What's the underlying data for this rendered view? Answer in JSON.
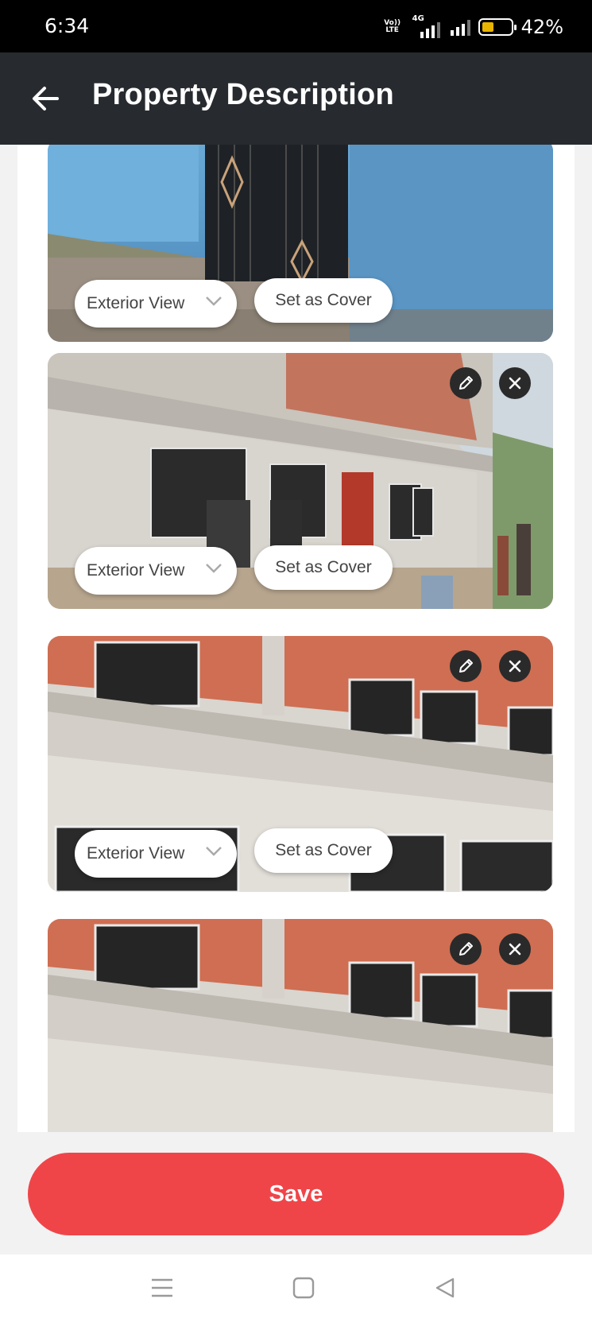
{
  "status_bar": {
    "time": "6:34",
    "volte_line1": "Vo))",
    "volte_line2": "LTE",
    "network_label": "4G",
    "battery_percent": "42%",
    "battery_level": 0.42,
    "battery_color": "#e8b400"
  },
  "header": {
    "title": "Property Description",
    "back_icon": "arrow-left-icon"
  },
  "photos": [
    {
      "category": "Exterior View",
      "cover_label": "Set as Cover",
      "scene": "blue-wall-gate",
      "show_actions": false
    },
    {
      "category": "Exterior View",
      "cover_label": "Set as Cover",
      "scene": "building-wide",
      "show_actions": true
    },
    {
      "category": "Exterior View",
      "cover_label": "Set as Cover",
      "scene": "building-closeup",
      "show_actions": true
    },
    {
      "category": "",
      "cover_label": "",
      "scene": "building-closeup",
      "show_actions": true
    }
  ],
  "photo_actions": {
    "edit_icon": "pencil-icon",
    "remove_icon": "close-icon",
    "dropdown_icon": "chevron-down-icon"
  },
  "save_label": "Save",
  "colors": {
    "accent": "#ef4549",
    "header": "#272b2f",
    "status_bar": "#000000"
  },
  "nav_bar": {
    "menu_icon": "menu-icon",
    "home_icon": "home-square-icon",
    "back_icon": "back-triangle-icon"
  }
}
